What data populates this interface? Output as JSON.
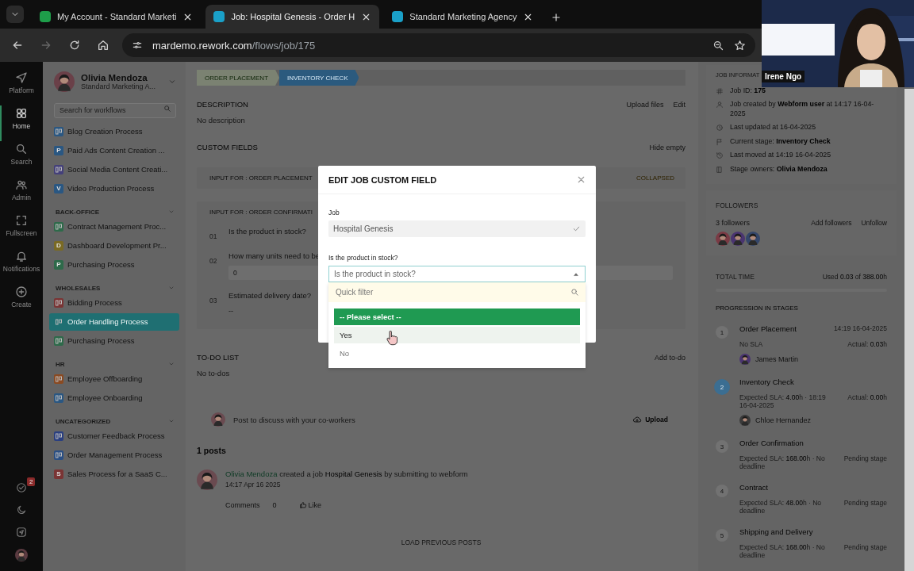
{
  "browser": {
    "tabs": [
      {
        "title": "My Account - Standard Marketi",
        "selected": false,
        "color": "#1e9e4a"
      },
      {
        "title": "Job: Hospital Genesis - Order H",
        "selected": true,
        "color": "#1aa0c8"
      },
      {
        "title": "Standard Marketing Agency",
        "selected": false,
        "color": "#1aa0c8"
      }
    ],
    "url_host": "mardemo.rework.com",
    "url_path": "/flows/job/175"
  },
  "video_call": {
    "name": "Irene Ngo"
  },
  "rail": {
    "items": [
      {
        "label": "Platform",
        "selected": false
      },
      {
        "label": "Home",
        "selected": true
      },
      {
        "label": "Search",
        "selected": false
      },
      {
        "label": "Admin",
        "selected": false
      },
      {
        "label": "Fullscreen",
        "selected": false
      },
      {
        "label": "Notifications",
        "selected": false
      },
      {
        "label": "Create",
        "selected": false
      }
    ],
    "task_badge": "2"
  },
  "sidebar": {
    "user": "Olivia Mendoza",
    "org": "Standard Marketing A...",
    "search_placeholder": "Search for workflows",
    "groups": [
      {
        "items": [
          {
            "label": "Blog Creation Process",
            "color": "#2a5782",
            "selected": false
          },
          {
            "label": "Paid Ads Content Creation ...",
            "color": "#2a5782",
            "letter": "P",
            "selected": false
          },
          {
            "label": "Social Media Content Creati...",
            "color": "#44407a",
            "selected": false
          },
          {
            "label": "Video Production Process",
            "color": "#2a5782",
            "letter": "V",
            "selected": false
          }
        ]
      },
      {
        "title": "BACK-OFFICE",
        "items": [
          {
            "label": "Contract Management Proc...",
            "color": "#2e6a4a",
            "selected": false
          },
          {
            "label": "Dashboard Development Pr...",
            "color": "#7a6a24",
            "letter": "D",
            "selected": false
          },
          {
            "label": "Purchasing Process",
            "color": "#2e6a4a",
            "letter": "P",
            "selected": false
          }
        ]
      },
      {
        "title": "WHOLESALES",
        "items": [
          {
            "label": "Bidding Process",
            "color": "#7a3434",
            "selected": false
          },
          {
            "label": "Order Handling Process",
            "color": "#1f6f72",
            "selected": true
          },
          {
            "label": "Purchasing Process",
            "color": "#2e6a4a",
            "selected": false
          }
        ]
      },
      {
        "title": "HR",
        "items": [
          {
            "label": "Employee Offboarding",
            "color": "#8a4a22",
            "selected": false
          },
          {
            "label": "Employee Onboarding",
            "color": "#2a5782",
            "selected": false
          }
        ]
      },
      {
        "title": "UNCATEGORIZED",
        "items": [
          {
            "label": "Customer Feedback Process",
            "color": "#2a3f80",
            "selected": false
          },
          {
            "label": "Order Management Process",
            "color": "#2a4f84",
            "selected": false
          },
          {
            "label": "Sales Process for a SaaS C...",
            "color": "#7a3434",
            "letter": "S",
            "selected": false
          }
        ]
      }
    ]
  },
  "main": {
    "stages": [
      {
        "label": "ORDER PLACEMENT",
        "kind": "done"
      },
      {
        "label": "INVENTORY CHECK",
        "kind": "current"
      }
    ],
    "description": {
      "title": "DESCRIPTION",
      "actions": [
        "Upload files",
        "Edit"
      ],
      "text": "No description"
    },
    "custom_fields": {
      "title": "CUSTOM FIELDS",
      "action": "Hide empty",
      "sections": [
        {
          "title": "INPUT FOR : ORDER PLACEMENT",
          "status": "COLLAPSED"
        },
        {
          "title": "INPUT FOR : ORDER CONFIRMATI",
          "fields": [
            {
              "number": "01",
              "question": "Is the product in stock?"
            },
            {
              "number": "02",
              "question": "How many units need to be",
              "value": "0"
            },
            {
              "number": "03",
              "question": "Estimated delivery date?",
              "value": "--"
            }
          ]
        }
      ]
    },
    "todo": {
      "title": "TO-DO LIST",
      "action": "Add to-do",
      "empty": "No to-dos"
    },
    "composer": {
      "placeholder": "Post to discuss with your co-workers",
      "upload": "Upload"
    },
    "posts": {
      "count": "1 posts",
      "items": [
        {
          "author": "Olivia Mendoza",
          "text": "created a job **Hospital Genesis** by submitting to webform",
          "time": "14:17 Apr 16 2025",
          "comments_label": "Comments",
          "comments": "0",
          "like": "Like"
        }
      ],
      "load_more": "LOAD PREVIOUS POSTS"
    }
  },
  "job_info": {
    "title": "JOB INFORMAT",
    "rows": [
      "Job ID: **175**",
      "Job created by **Webform user** at 14:17 16-04-2025",
      "Last updated at 16-04-2025",
      "Current stage: **Inventory Check**",
      "Last moved at 14:19 16-04-2025",
      "Stage owners: **Olivia Mendoza**"
    ]
  },
  "followers": {
    "title": "FOLLOWERS",
    "count": "3 followers",
    "actions": [
      "Add followers",
      "Unfollow"
    ],
    "avatars": [
      {
        "color": "#7a3a44"
      },
      {
        "color": "#4a3470"
      },
      {
        "color": "#34466a"
      }
    ]
  },
  "total_time": {
    "title": "TOTAL TIME",
    "used": "Used **0.03** of **388.00**h"
  },
  "progression": {
    "title": "PROGRESSION IN STAGES",
    "stages": [
      {
        "number": "1",
        "name": "Order Placement",
        "time": "14:19 16-04-2025",
        "sla": "No SLA",
        "actual": "Actual: **0.03**h",
        "owner": "James Martin",
        "kind": "done"
      },
      {
        "number": "2",
        "name": "Inventory Check",
        "sla": "Expected SLA: **4.00**h · 18:19 16-04-2025",
        "actual": "Actual: **0.00**h",
        "owner": "Chloe Hernandez",
        "kind": "current"
      },
      {
        "number": "3",
        "name": "Order Confirmation",
        "sla": "Expected SLA: **168.00**h · No deadline",
        "status": "Pending stage",
        "kind": "pending"
      },
      {
        "number": "4",
        "name": "Contract",
        "sla": "Expected SLA: **48.00**h · No deadline",
        "status": "Pending stage",
        "kind": "pending"
      },
      {
        "number": "5",
        "name": "Shipping and Delivery",
        "sla": "Expected SLA: **168.00**h · No deadline",
        "status": "Pending stage",
        "kind": "pending"
      }
    ]
  },
  "modal": {
    "title": "EDIT JOB CUSTOM FIELD",
    "job_label": "Job",
    "job_value": "Hospital Genesis",
    "question_label": "Is the product in stock?",
    "select_placeholder": "Is the product in stock?",
    "filter_placeholder": "Quick filter",
    "options": [
      {
        "label": "-- Please select --",
        "selected": true,
        "hovered": false
      },
      {
        "label": "Yes",
        "selected": false,
        "hovered": true
      },
      {
        "label": "No",
        "selected": false,
        "hovered": false
      }
    ]
  }
}
